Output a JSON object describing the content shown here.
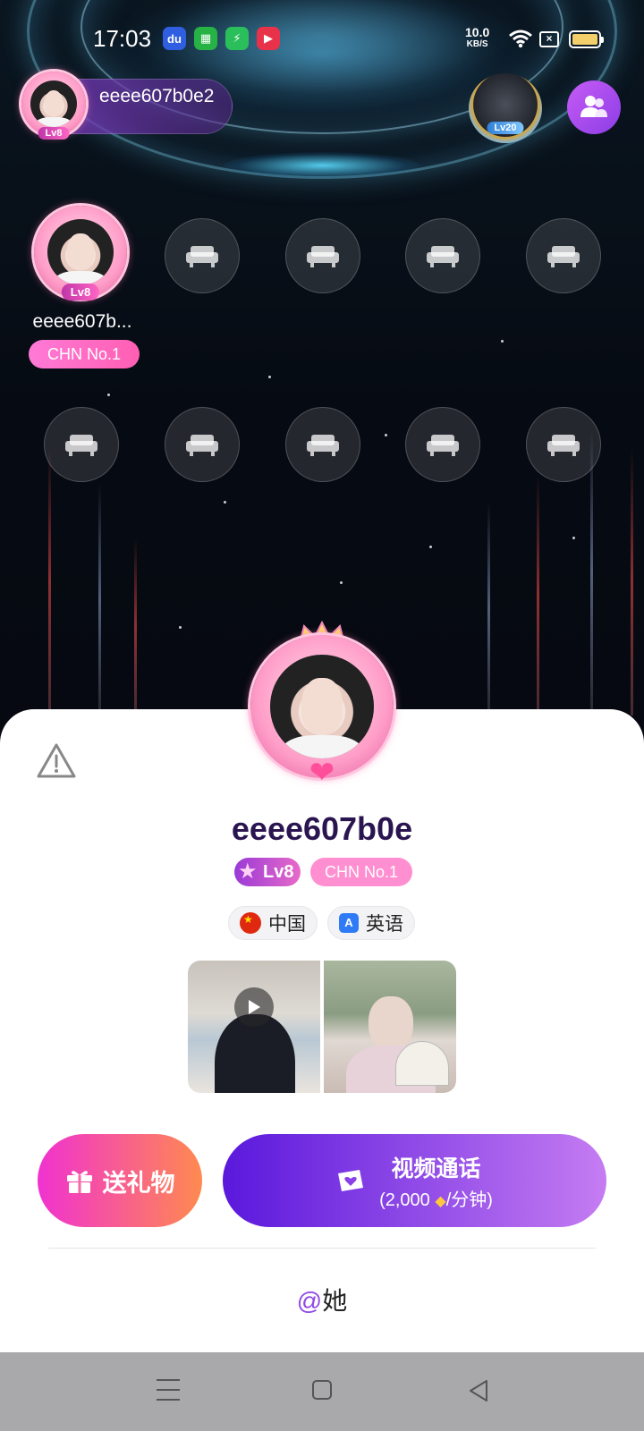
{
  "status_bar": {
    "time": "17:03",
    "net_speed_value": "10.0",
    "net_speed_unit": "KB/S",
    "battery_color": "#f3cf6b",
    "app_icons": [
      "baidu-app-icon",
      "green-app-icon",
      "security-app-icon",
      "video-app-icon"
    ]
  },
  "room": {
    "host_name": "eeee607b0e2",
    "host_level": "Lv8",
    "top_badge_level": "Lv20"
  },
  "seats": {
    "occupied": {
      "name": "eeee607b...",
      "level": "Lv8",
      "badge": "CHN No.1"
    },
    "empty_seat_icon": "sofa-icon",
    "empty_count": 9
  },
  "profile": {
    "name": "eeee607b0e",
    "level": "Lv8",
    "rank": "CHN No.1",
    "country": "中国",
    "language": "英语",
    "accent": "#8b3de6"
  },
  "actions": {
    "gift_label": "送礼物",
    "call_title": "视频通话",
    "call_price_prefix": "(2,000",
    "call_price_suffix": "/分钟)",
    "mention_at": "@",
    "mention_label": "她"
  }
}
